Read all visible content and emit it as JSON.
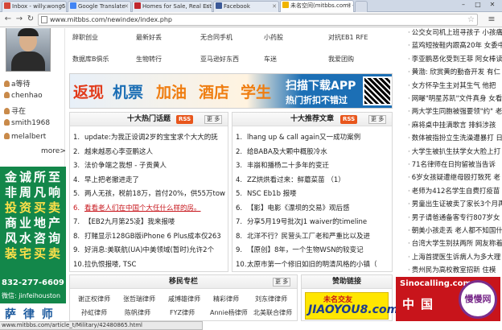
{
  "browser": {
    "tabs": [
      {
        "label": "Inbox - willy.wong519@gm",
        "active": false,
        "favicon": "#d44638"
      },
      {
        "label": "Google Translate",
        "active": false,
        "favicon": "#4285f4"
      },
      {
        "label": "Homes for Sale, Real Esta",
        "active": false,
        "favicon": "#c1272d"
      },
      {
        "label": "Facebook",
        "active": false,
        "favicon": "#3b5998"
      },
      {
        "label": "未名空间(mitbbs.com) -",
        "active": true,
        "favicon": "#f0b400"
      }
    ],
    "window_controls": [
      "–",
      "□",
      "✕"
    ],
    "url": "www.mitbbs.com/newindex/index.php",
    "status_url": "www.mitbbs.com/article_t/Military/42480865.html"
  },
  "left": {
    "friends": [
      "a等待",
      "chenhao",
      "寻在",
      "smith1968",
      "melalbert"
    ],
    "more_label": "more>",
    "ad_chars": [
      "金",
      "诚",
      "所",
      "至",
      "非",
      "周",
      "凡",
      "响",
      "投",
      "资",
      "买",
      "卖",
      "商",
      "业",
      "地",
      "产",
      "风",
      "水",
      "咨",
      "询",
      "装",
      "宅",
      "买",
      "卖"
    ],
    "ad_phone": "832-277-6609",
    "ad_wechat": "微信: jinfeihouston",
    "ad_bottom": "萨 律 师"
  },
  "nav": {
    "row1": [
      "辞职创业",
      "最新好丢",
      "无合同手机",
      "小药股",
      "对抗EB1 RFE"
    ],
    "row2": [
      "数据库B俱乐",
      "生物转行",
      "亚马逊好东西",
      "车迷",
      "我爱团购"
    ]
  },
  "banner": {
    "words": [
      "返现",
      "机票",
      "加油",
      "酒店",
      "学生"
    ],
    "app_line1": "扫描下载APP",
    "app_line2": "热门折扣不错过"
  },
  "hot_topics": {
    "title": "十大热门话题",
    "rss": "RSS",
    "more": "更 多",
    "items": [
      "update:为我正设调2岁的宝宝求个大大的抚",
      "越来越恶心李亚鹏这人",
      "法价争端之我想 - 子贡黄人",
      "早上把老撤进走了",
      "两人无孩，税前18万，首付20%，供55万tow",
      "看看老人们在中国个大任什么样的房。",
      "【EB2九月第25凌】我来报喽",
      "打赌显示128GB版iPhone 6 Plus成本仅263",
      "好消息:美联航(UA)中美领域(暂时)允许2个",
      "拉仇恨报喽, TSC"
    ]
  },
  "recommended": {
    "title": "十大推荐文章",
    "rss": "RSS",
    "more": "更 多",
    "items": [
      "lhang up & call again又一成功案例",
      "给BABA及大颗中概股冷水",
      "丰崩和播杨二十多年的变迁",
      "ZZ烘烘看过来：鲜蘑菜苗 （1）",
      "NSC Eb1b 报喽",
      "【影】电影《漂坝的交易》观后感",
      "分享5月19号批次J1 waiver的timeline",
      "北洋不行？民营头工厂老和严重比以及进",
      "【原创】8年，一个生物WSN的较变记",
      "太原市第一个修旧如旧的明清风格的小镇（"
    ]
  },
  "immigration": {
    "title": "移民专栏",
    "more": "更 多",
    "row1": [
      "谢正权律师",
      "张哲瑞律师",
      "戚博雄律师",
      "精彩律师",
      "刘东律律师"
    ],
    "row2": [
      "孙虹律师",
      "陈帆律师",
      "FYZ律师",
      "Annie杨律师",
      "北美联合律师"
    ]
  },
  "sponsor": {
    "title": "赞助链接",
    "ad_top": "未名交友",
    "ad_main": "JIAOYOU8.com"
  },
  "sino": {
    "label": "Sinocalling.com",
    "tag": "中国",
    "badge": "慢慢网"
  },
  "right_links": [
    "公交女司机上班寻孩子 小孩痛",
    "蓝鸡短按鞋内跟高20年 女委中",
    "李亚鹏恶化受到王菲 阿女棒读",
    "黄渤: 欣赏黄的勤奋开发 有仁",
    "女方怀孕生主对其生气 他把",
    "网曝\"明星苏凯\"文件真身 女看",
    "两大学生同胞被强要领\"约\" 老",
    "麻将桌中挂满歌言 排斜涉孩",
    "数体被指扮立生洗澡遭暴打 日",
    "大学生被扒生扶学女大脸上打",
    "71名律师在日拘留被当告诉",
    "6岁女孩疑遭继母殴打致死 老",
    "老师为412名学生自费打疫苗",
    "男童出生证被卖了家长3个月再",
    "男子请爸通备客专行807岁女",
    "朝美小孩走丢 老人都不知国什",
    "台湾大学生别扶两所 网友称着",
    "上海首提医生诉病人为多大理",
    "贵州民为高校教室招新 住模"
  ],
  "colors": {
    "accent_red": "#c7161c",
    "rss_orange": "#e8561c",
    "ad_green": "#13874a",
    "banner_orange": "#ef7d10",
    "banner_blue": "#1c6fb5"
  }
}
